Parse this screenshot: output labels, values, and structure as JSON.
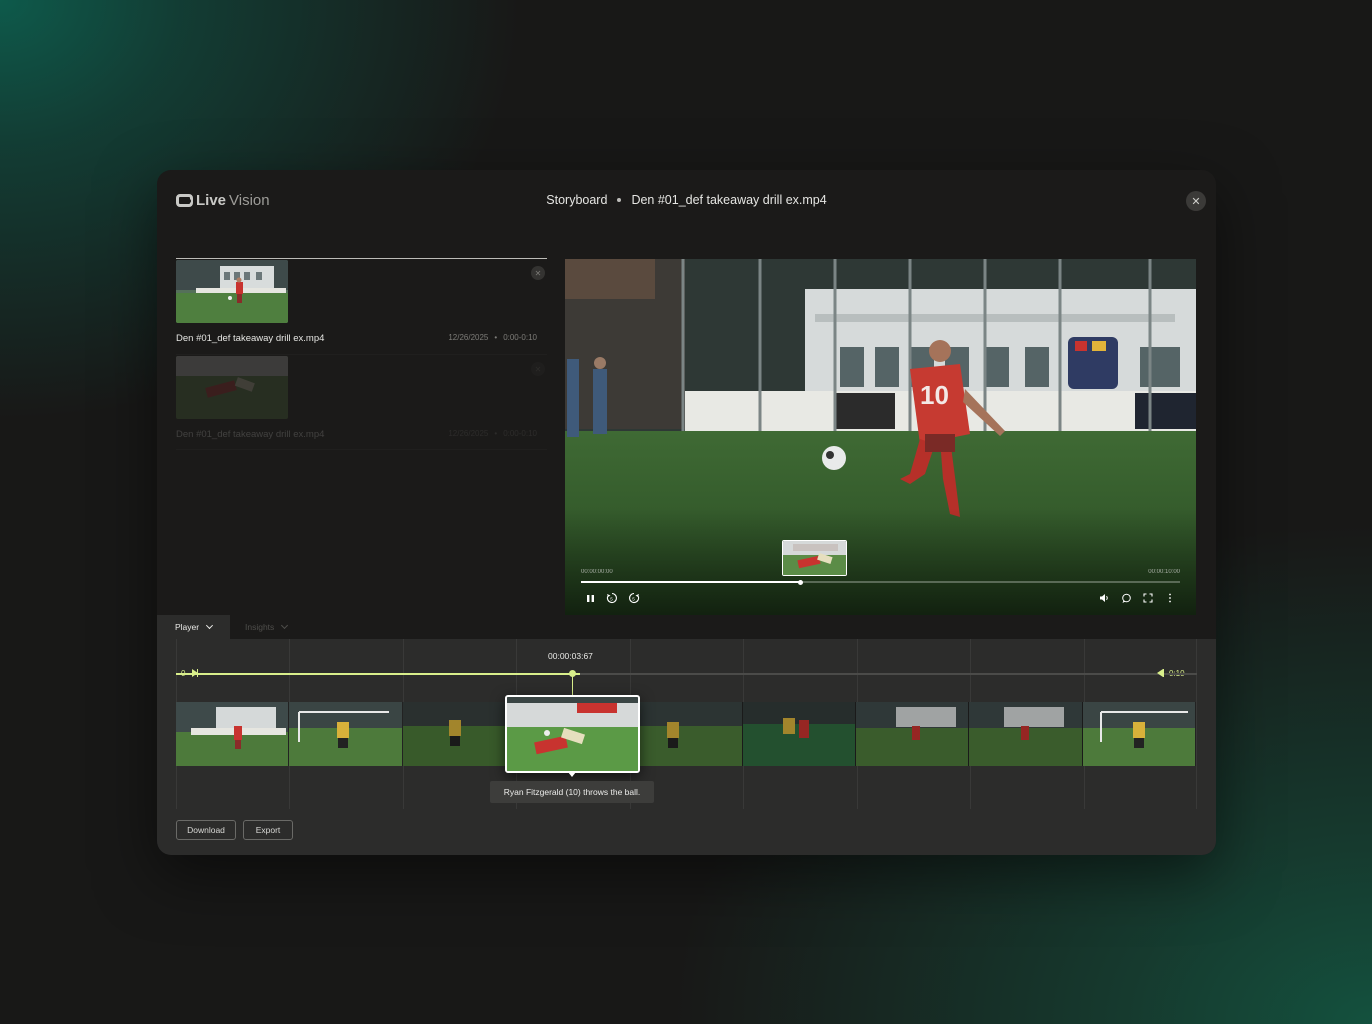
{
  "app": {
    "logo_primary": "Live",
    "logo_secondary": "Vision"
  },
  "header": {
    "section": "Storyboard",
    "file": "Den #01_def takeaway drill ex.mp4",
    "close_icon": "close-icon"
  },
  "clips": [
    {
      "name": "Den #01_def takeaway drill ex.mp4",
      "date": "12/26/2025",
      "range": "0:00-0:10",
      "active": true
    },
    {
      "name": "Den #01_def takeaway drill ex.mp4",
      "date": "12/26/2025",
      "range": "0:00-0:10",
      "active": false
    }
  ],
  "player": {
    "time_start": "00:00:00:00",
    "time_end": "00:00:10:00",
    "progress": 0.367,
    "controls": [
      "pause-icon",
      "rewind-5-icon",
      "forward-5-icon",
      "volume-icon",
      "comment-icon",
      "fullscreen-icon",
      "more-icon"
    ]
  },
  "tabs": [
    {
      "label": "Player",
      "active": true
    },
    {
      "label": "Insights",
      "active": false
    }
  ],
  "timeline": {
    "current_time": "00:00:03:67",
    "start_label": "0",
    "end_label": "0:10",
    "tooltip": "Ryan Fitzgerald (10) throws the ball."
  },
  "actions": {
    "download": "Download",
    "export": "Export"
  },
  "colors": {
    "accent": "#d9ef8b",
    "panel": "#2c2c2b",
    "window": "#1b1a19"
  }
}
